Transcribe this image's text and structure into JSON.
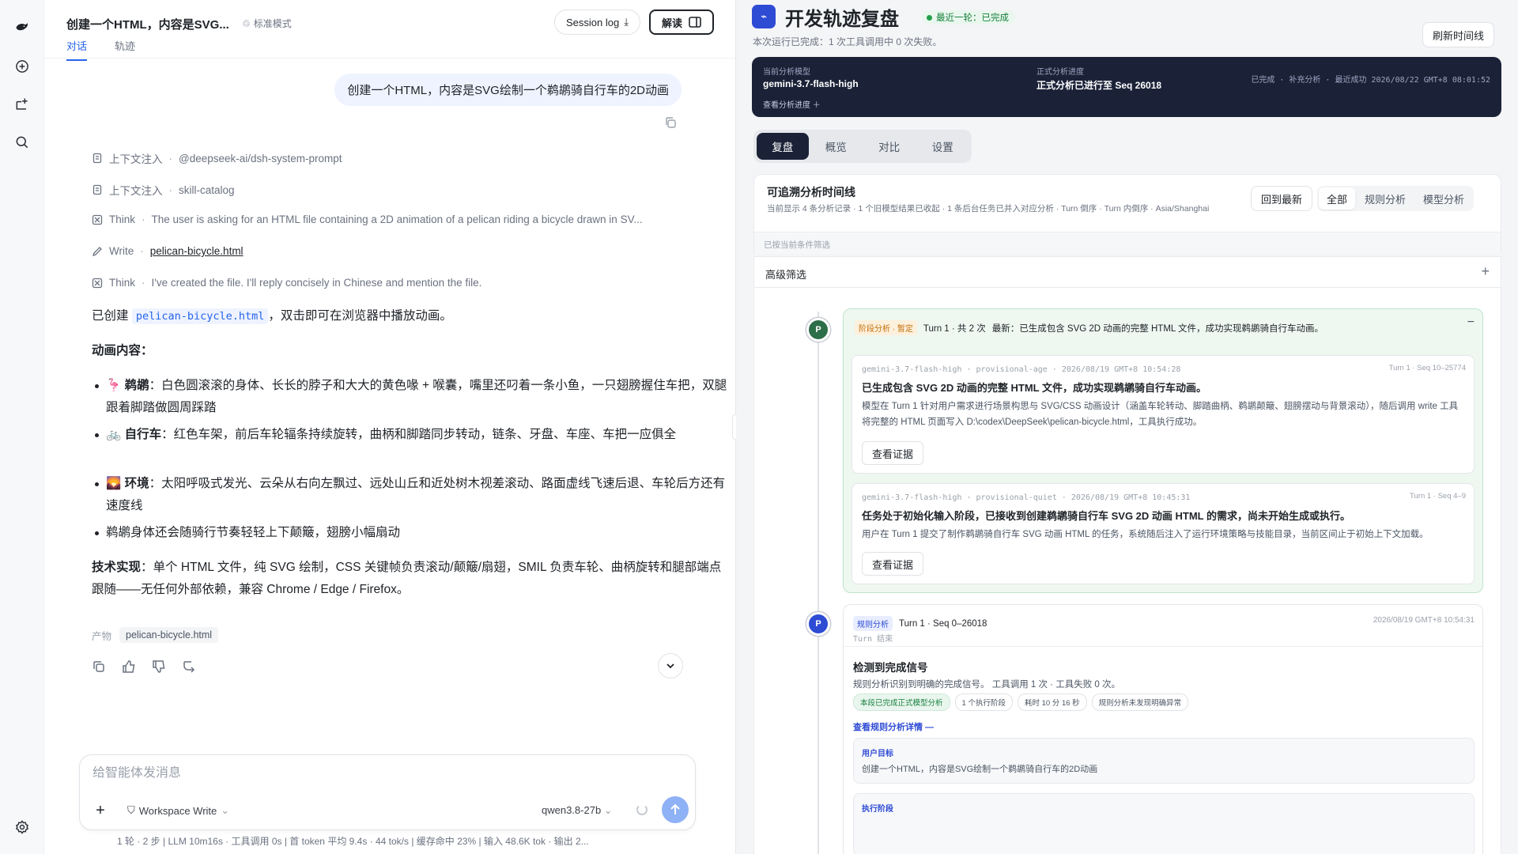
{
  "rail": {
    "icons": [
      "logo-whale-icon",
      "new-chat-icon",
      "add-project-icon",
      "search-icon",
      "settings-icon"
    ]
  },
  "chat": {
    "title": "创建一个HTML，内容是SVG...",
    "mode": "标准模式",
    "tabs": [
      "对话",
      "轨迹"
    ],
    "session_log": "Session log",
    "explain": "解读",
    "user_message": "创建一个HTML，内容是SVG绘制一个鹈鹕骑自行车的2D动画",
    "steps": [
      {
        "kind": "上下文注入",
        "detail": "@deepseek-ai/dsh-system-prompt"
      },
      {
        "kind": "上下文注入",
        "detail": "skill-catalog"
      },
      {
        "kind": "Think",
        "detail": "The user is asking for an HTML file containing a 2D animation of a pelican riding a bicycle drawn in SV..."
      },
      {
        "kind": "Write",
        "detail": "pelican-bicycle.html"
      },
      {
        "kind": "Think",
        "detail": "I've created the file. I'll reply concisely in Chinese and mention the file."
      }
    ],
    "answer": {
      "intro_pre": "已创建",
      "intro_code": "pelican-bicycle.html",
      "intro_post": "，双击即可在浏览器中播放动画。",
      "section_title": "动画内容：",
      "bullets": [
        {
          "emoji": "🦩",
          "label": "鹈鹕",
          "text": "：白色圆滚滚的身体、长长的脖子和大大的黄色喙 + 喉囊，嘴里还叼着一条小鱼，一只翅膀握住车把，双腿跟着脚踏做圆周踩踏"
        },
        {
          "emoji": "🚲",
          "label": "自行车",
          "text": "：红色车架，前后车轮辐条持续旋转，曲柄和脚踏同步转动，链条、牙盘、车座、车把一应俱全"
        },
        {
          "emoji": "🌄",
          "label": "环境",
          "text": "：太阳呼吸式发光、云朵从右向左飘过、远处山丘和近处树木视差滚动、路面虚线飞速后退、车轮后方还有速度线"
        },
        {
          "emoji": "",
          "label": "",
          "text": "鹈鹕身体还会随骑行节奏轻轻上下颠簸，翅膀小幅扇动"
        }
      ],
      "tech_label": "技术实现",
      "tech_text": "：单个 HTML 文件，纯 SVG 绘制，CSS 关键帧负责滚动/颠簸/扇翅，SMIL 负责车轮、曲柄旋转和腿部端点跟随——无任何外部依赖，兼容 Chrome / Edge / Firefox。"
    },
    "artifact_label": "产物",
    "artifact_file": "pelican-bicycle.html",
    "composer": {
      "placeholder": "给智能体发消息",
      "workspace": "Workspace Write",
      "model": "qwen3.8-27b"
    },
    "statusbar": "1 轮 · 2 步   |   LLM 10m16s · 工具调用 0s   |   首 token 平均 9.4s · 44 tok/s   |   缓存命中 23%   |   输入 48.6K tok · 输出 2..."
  },
  "panel": {
    "title": "开发轨迹复盘",
    "status": "最近一轮：已完成",
    "subtitle": "本次运行已完成：1 次工具调用中 0 次失败。",
    "refresh": "刷新时间线",
    "dark": {
      "model_label": "当前分析模型",
      "model_value": "gemini-3.7-flash-high",
      "progress_label": "正式分析进度",
      "progress_value": "正式分析已进行至 Seq 26018",
      "view_progress": "查看分析进度 ＋",
      "meta": "已完成 · 补充分析 · 最近成功 2026/08/22 GMT+8 08:01:52"
    },
    "seg_tabs": [
      "复盘",
      "概览",
      "对比",
      "设置"
    ],
    "timeline_card": {
      "title": "可追溯分析时间线",
      "subtitle": "当前显示 4 条分析记录 · 1 个旧模型结果已收起 · 1 条后台任务已并入对应分析 · Turn 倒序 · Turn 内倒序 · Asia/Shanghai",
      "back_latest": "回到最新",
      "filter_tabs": [
        "全部",
        "规则分析",
        "模型分析"
      ],
      "filtered_note": "已按当前条件筛选"
    },
    "advanced_filter": "高级筛选",
    "stage": {
      "node": "P",
      "tag1": "阶段分析 · 暂定",
      "turn": "Turn 1 · 共 2 次",
      "latest": "最新：已生成包含 SVG 2D 动画的完整 HTML 文件，成功实现鹈鹕骑自行车动画。",
      "evidences": [
        {
          "meta": "gemini-3.7-flash-high · provisional-age · 2026/08/19 GMT+8 10:54:28",
          "right": "Turn 1 · Seq 10–25774",
          "title": "已生成包含 SVG 2D 动画的完整 HTML 文件，成功实现鹈鹕骑自行车动画。",
          "body": "模型在 Turn 1 针对用户需求进行场景构思与 SVG/CSS 动画设计（涵盖车轮转动、脚踏曲柄、鹈鹕颠簸、翅膀摆动与背景滚动），随后调用 write 工具将完整的 HTML 页面写入 D:\\codex\\DeepSeek\\pelican-bicycle.html，工具执行成功。",
          "button": "查看证据"
        },
        {
          "meta": "gemini-3.7-flash-high · provisional-quiet · 2026/08/19 GMT+8 10:45:31",
          "right": "Turn 1 · Seq 4–9",
          "title": "任务处于初始化输入阶段，已接收到创建鹈鹕骑自行车 SVG 2D 动画 HTML 的需求，尚未开始生成或执行。",
          "body": "用户在 Turn 1 提交了制作鹈鹕骑自行车 SVG 动画 HTML 的任务，系统随后注入了运行环境策略与技能目录，当前区间止于初始上下文加载。",
          "button": "查看证据"
        }
      ]
    },
    "rule": {
      "node": "P",
      "tag": "规则分析",
      "turn": "Turn 1 · Seq 0–26018",
      "sub": "Turn 结束",
      "time": "2026/08/19 GMT+8 10:54:31",
      "title": "检测到完成信号",
      "desc": "规则分析识别到明确的完成信号。 工具调用 1 次 · 工具失败 0 次。",
      "chips": [
        "本段已完成正式模型分析",
        "1 个执行阶段",
        "耗时 10 分 16 秒",
        "规则分析未发现明确异常"
      ],
      "more": "查看规则分析详情 —",
      "goal_label": "用户目标",
      "goal_value": "创建一个HTML，内容是SVG绘制一个鹈鹕骑自行车的2D动画",
      "phase_label": "执行阶段"
    }
  }
}
